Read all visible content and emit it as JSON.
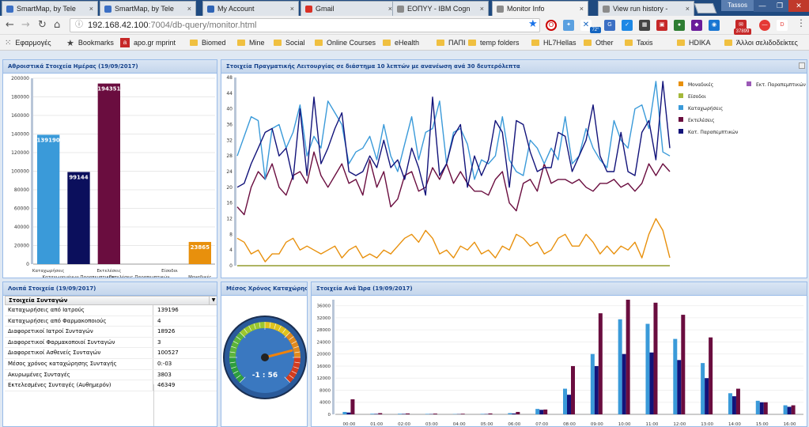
{
  "browser": {
    "tabs": [
      {
        "title": "SmartMap, by Tele",
        "icon": "map-icon",
        "color": "#3b6fc4"
      },
      {
        "title": "SmartMap, by Tele",
        "icon": "map-icon",
        "color": "#3b6fc4"
      },
      {
        "title": "My Account",
        "icon": "account-icon",
        "color": "#2f64b5"
      },
      {
        "title": "Gmail",
        "icon": "gmail-icon",
        "color": "#d93025"
      },
      {
        "title": "ΕΟΠΥΥ - IBM Cogn",
        "icon": "document-icon",
        "color": "#8b8b8b"
      },
      {
        "title": "Monitor Info",
        "icon": "document-icon",
        "color": "#8b8b8b"
      },
      {
        "title": "View run history -",
        "icon": "document-icon",
        "color": "#8b8b8b"
      }
    ],
    "user": "Tassos",
    "url_host": "192.168.42.100",
    "url_path": ":7004/db-query/monitor.html",
    "ext_badges": {
      "weather": "72°",
      "mail": "37899"
    },
    "bookmarks": [
      {
        "label": "Εφαρμογές",
        "icon": "apps-icon"
      },
      {
        "label": "Bookmarks",
        "icon": "star-icon"
      },
      {
        "label": "apo.gr mprint",
        "icon": "apo-icon"
      },
      {
        "label": "Biomed",
        "icon": "folder-icon"
      },
      {
        "label": "Mine",
        "icon": "folder-icon"
      },
      {
        "label": "Social",
        "icon": "folder-icon"
      },
      {
        "label": "Online Courses",
        "icon": "folder-icon"
      },
      {
        "label": "eHealth",
        "icon": "folder-icon"
      },
      {
        "label": "ΠΑΠΙ",
        "icon": "folder-icon"
      },
      {
        "label": "temp folders",
        "icon": "folder-icon"
      },
      {
        "label": "HL7Hellas",
        "icon": "folder-icon"
      },
      {
        "label": "Other",
        "icon": "folder-icon"
      },
      {
        "label": "Taxis",
        "icon": "folder-icon"
      },
      {
        "label": "HDIKA",
        "icon": "folder-icon"
      },
      {
        "label": "Άλλοι σελιδοδείκτες",
        "icon": "folder-icon"
      }
    ]
  },
  "panels": {
    "daily_title": "Αθροιστικά Στοιχεία Ημέρας (19/09/2017)",
    "realtime_title": "Στοιχεία Πραγματικής Λειτουργίας σε διάστημα 10 λεπτών με ανανέωση ανά 30 δευτερόλεπτα",
    "other_title": "Λοιπά Στοιχεία (19/09/2017)",
    "avg_title": "Μέσος Χρόνος Καταχώρησης",
    "hourly_title": "Στοιχεία Ανά Ώρα (19/09/2017)"
  },
  "grid": {
    "header": "Στοιχεία Συνταγών",
    "rows": [
      {
        "label": "Καταχωρήσεις από Ιατρούς",
        "value": "139196"
      },
      {
        "label": "Καταχωρήσεις από Φαρμακοποιούς",
        "value": "4"
      },
      {
        "label": "Διαφορετικοί Ιατροί Συνταγών",
        "value": "18926"
      },
      {
        "label": "Διαφορετικοί Φαρμακοποιοί Συνταγών",
        "value": "3"
      },
      {
        "label": "Διαφορετικοί Ασθενείς Συνταγών",
        "value": "100527"
      },
      {
        "label": "Μέσος χρόνος καταχώρησης Συνταγής",
        "value": "0:-03"
      },
      {
        "label": "Ακυρωμένες Συνταγές",
        "value": "3803"
      },
      {
        "label": "Εκτελεσμένες Συνταγές (Αυθημερόν)",
        "value": "46349"
      }
    ]
  },
  "gauge": {
    "value_label": "-1 : 56",
    "value_fraction": 0.78
  },
  "chart_data": [
    {
      "type": "bar",
      "title": "Αθροιστικά Στοιχεία Ημέρας (19/09/2017)",
      "categories": [
        "Καταχωρήσεις",
        "Καταχωρημένων Παραπεμπτικών",
        "Εκτελέσεις",
        "Εκτελέσεις Παραπεμπτικών",
        "Είσοδοι",
        "Μοναδικές"
      ],
      "values": [
        139190,
        99144,
        194351,
        0,
        0,
        23865
      ],
      "labels": [
        "139190",
        "99144",
        "194351",
        "",
        "",
        "23865"
      ],
      "colors": [
        "#3a9ad9",
        "#0b0f5c",
        "#6a0d3f",
        "#9b59b6",
        "#7cb342",
        "#e8900c"
      ],
      "ylim": [
        0,
        200000
      ],
      "yticks": [
        0,
        20000,
        40000,
        60000,
        80000,
        100000,
        120000,
        140000,
        160000,
        180000,
        200000
      ]
    },
    {
      "type": "line",
      "title": "Στοιχεία Πραγματικής Λειτουργίας σε διάστημα 10 λεπτών με ανανέωση ανά 30 δευτερόλεπτα",
      "ylim": [
        0,
        48
      ],
      "yticks": [
        0,
        4,
        8,
        12,
        16,
        20,
        24,
        28,
        32,
        36,
        40,
        44,
        48
      ],
      "legend": [
        {
          "name": "Μοναδικές",
          "color": "#e8900c"
        },
        {
          "name": "Εκτ. Παραπεμπτικών",
          "color": "#9b59b6"
        },
        {
          "name": "Είσοδοι",
          "color": "#a4b83a"
        },
        {
          "name": "Καταχωρήσεις",
          "color": "#3a9ad9"
        },
        {
          "name": "Εκτελέσεις",
          "color": "#6a0d3f"
        },
        {
          "name": "Κατ. Παραπεμπτικών",
          "color": "#12137a"
        }
      ],
      "series": [
        {
          "name": "Καταχωρήσεις",
          "color": "#3a9ad9",
          "values": [
            28,
            33,
            38,
            37,
            22,
            35,
            36,
            30,
            34,
            41,
            28,
            33,
            30,
            42,
            39,
            36,
            26,
            29,
            30,
            33,
            27,
            36,
            28,
            24,
            31,
            38,
            27,
            34,
            35,
            42,
            26,
            34,
            35,
            31,
            22,
            27,
            26,
            28,
            38,
            27,
            24,
            23,
            32,
            30,
            26,
            30,
            27,
            38,
            26,
            28,
            35,
            30,
            27,
            25,
            37,
            32,
            30,
            40,
            41,
            35,
            47,
            29,
            28
          ]
        },
        {
          "name": "Καtt. Παραπεμπτικών",
          "color": "#12137a",
          "values": [
            20,
            21,
            26,
            30,
            34,
            35,
            28,
            30,
            22,
            40,
            23,
            43,
            26,
            30,
            35,
            39,
            24,
            23,
            24,
            28,
            25,
            32,
            25,
            27,
            22,
            30,
            25,
            18,
            43,
            23,
            26,
            33,
            36,
            20,
            28,
            23,
            27,
            37,
            34,
            20,
            37,
            36,
            29,
            24,
            25,
            25,
            34,
            33,
            24,
            28,
            32,
            41,
            28,
            24,
            24,
            34,
            24,
            23,
            34,
            37,
            27,
            47,
            30
          ]
        },
        {
          "name": "Εκτελέσεις",
          "color": "#6a0d3f",
          "values": [
            15,
            13,
            20,
            24,
            22,
            26,
            20,
            18,
            23,
            24,
            21,
            29,
            23,
            20,
            23,
            26,
            21,
            22,
            18,
            27,
            20,
            24,
            15,
            17,
            23,
            24,
            19,
            20,
            25,
            22,
            26,
            21,
            24,
            21,
            19,
            19,
            18,
            22,
            24,
            16,
            14,
            21,
            22,
            19,
            26,
            21,
            22,
            22,
            21,
            22,
            20,
            19,
            21,
            21,
            22,
            20,
            21,
            19,
            21,
            26,
            23,
            26,
            24
          ]
        },
        {
          "name": "Μοναδικές",
          "color": "#e8900c",
          "values": [
            7,
            6,
            3,
            4,
            1,
            3,
            3,
            6,
            7,
            4,
            5,
            4,
            3,
            4,
            5,
            2,
            4,
            5,
            2,
            3,
            2,
            4,
            3,
            5,
            7,
            8,
            6,
            9,
            7,
            3,
            4,
            2,
            5,
            4,
            6,
            3,
            4,
            2,
            5,
            4,
            8,
            7,
            5,
            6,
            3,
            4,
            7,
            8,
            5,
            5,
            8,
            6,
            3,
            5,
            3,
            5,
            4,
            6,
            2,
            8,
            12,
            9,
            2
          ]
        },
        {
          "name": "Είσοδοι",
          "color": "#a4b83a",
          "values": [
            0,
            0,
            0,
            0,
            0,
            0,
            0,
            0,
            0,
            0,
            0,
            0,
            0,
            0,
            0,
            0,
            0,
            0,
            0,
            0,
            0,
            0,
            0,
            0,
            0,
            0,
            0,
            0,
            0,
            0,
            0,
            0,
            0,
            0,
            0,
            0,
            0,
            0,
            0,
            0,
            0,
            0,
            0,
            0,
            0,
            0,
            0,
            0,
            0,
            0,
            0,
            0,
            0,
            0,
            0,
            0,
            0,
            0,
            0,
            0,
            0,
            0,
            0
          ]
        },
        {
          "name": "Εκτ. Παραπεμπτικών",
          "color": "#9b59b6",
          "values": [
            0,
            0,
            0,
            0,
            0,
            0,
            0,
            0,
            0,
            0,
            0,
            0,
            0,
            0,
            0,
            0,
            0,
            0,
            0,
            0,
            0,
            0,
            0,
            0,
            0,
            0,
            0,
            0,
            0,
            0,
            0,
            0,
            0,
            0,
            0,
            0,
            0,
            0,
            0,
            0,
            0,
            0,
            0,
            0,
            0,
            0,
            0,
            0,
            0,
            0,
            0,
            0,
            0,
            0,
            0,
            0,
            0,
            0,
            0,
            0,
            0,
            0,
            0
          ]
        }
      ]
    },
    {
      "type": "bar",
      "title": "Στοιχεία Ανά Ώρα (19/09/2017)",
      "ylim": [
        0,
        38000
      ],
      "yticks": [
        0,
        4000,
        8000,
        12000,
        16000,
        20000,
        24000,
        28000,
        32000,
        36000
      ],
      "categories": [
        "00:00",
        "01:00",
        "02:00",
        "03:00",
        "04:00",
        "05:00",
        "06:00",
        "07:00",
        "08:00",
        "09:00",
        "10:00",
        "11:00",
        "12:00",
        "13:00",
        "14:00",
        "15:00",
        "16:00"
      ],
      "series": [
        {
          "name": "Καταχωρήσεις",
          "color": "#3a9ad9",
          "values": [
            800,
            200,
            200,
            150,
            100,
            150,
            400,
            1800,
            8500,
            20000,
            31500,
            30000,
            25000,
            17000,
            7000,
            4500,
            3000
          ]
        },
        {
          "name": "Καtt. Παραπεμπτικών",
          "color": "#12137a",
          "values": [
            600,
            150,
            150,
            100,
            80,
            100,
            300,
            1500,
            6500,
            16000,
            20000,
            20500,
            18000,
            12000,
            6000,
            4000,
            2500
          ]
        },
        {
          "name": "Εκτελέσεις",
          "color": "#6a0d3f",
          "values": [
            5000,
            400,
            300,
            250,
            200,
            300,
            800,
            1600,
            16000,
            33500,
            39000,
            37000,
            33000,
            25500,
            8500,
            4000,
            3000
          ]
        }
      ]
    }
  ]
}
